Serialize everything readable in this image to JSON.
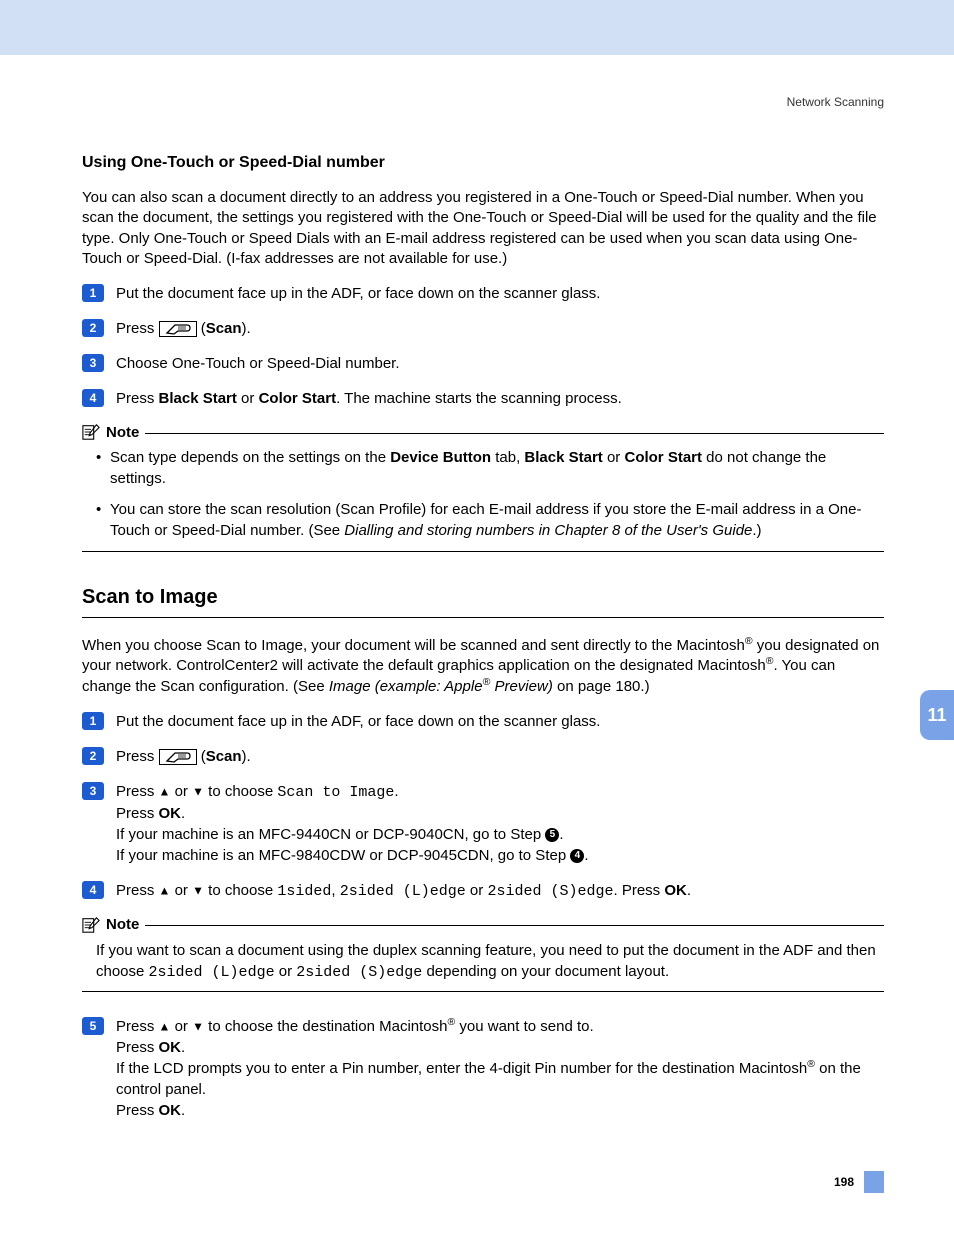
{
  "header": {
    "section": "Network Scanning"
  },
  "sideTab": "11",
  "section1": {
    "title": "Using One-Touch or Speed-Dial number",
    "intro": "You can also scan a document directly to an address you registered in a One-Touch or Speed-Dial number. When you scan the document, the settings you registered with the One-Touch or Speed-Dial will be used for the quality and the file type. Only One-Touch or Speed Dials with an E-mail address registered can be used when you scan data using One-Touch or Speed-Dial. (I-fax addresses are not available for use.)",
    "steps": {
      "s1": "Put the document face up in the ADF, or face down on the scanner glass.",
      "s2_press": "Press ",
      "s2_scan": "Scan",
      "s3": "Choose One-Touch or Speed-Dial number.",
      "s4_a": "Press ",
      "s4_b1": "Black Start",
      "s4_or": " or ",
      "s4_b2": "Color Start",
      "s4_c": ". The machine starts the scanning process."
    },
    "note": {
      "label": "Note",
      "b1_a": "Scan type depends on the settings on the ",
      "b1_b": "Device Button",
      "b1_c": " tab, ",
      "b1_d": "Black Start",
      "b1_e": " or ",
      "b1_f": "Color Start",
      "b1_g": " do not change the settings.",
      "b2_a": "You can store the scan resolution (Scan Profile) for each E-mail address if you store the E-mail address in a One-Touch or Speed-Dial number. (See ",
      "b2_b": "Dialling and storing numbers in Chapter 8 of the User's Guide",
      "b2_c": ".)"
    }
  },
  "section2": {
    "title": "Scan to Image",
    "intro_a": "When you choose Scan to Image, your document will be scanned and sent directly to the Macintosh",
    "intro_b": " you designated on your network. ControlCenter2 will activate the default graphics application on the designated Macintosh",
    "intro_c": ". You can change the Scan configuration. (See ",
    "intro_d": "Image (example: Apple",
    "intro_e": " Preview)",
    "intro_f": " on page 180.)",
    "steps": {
      "s1": "Put the document face up in the ADF, or face down on the scanner glass.",
      "s2_press": "Press ",
      "s2_scan": "Scan",
      "s3_a": "Press ",
      "s3_b": " or ",
      "s3_c": " to choose ",
      "s3_d": "Scan to Image",
      "s3_e": ".",
      "s3_f": "Press ",
      "s3_g": "OK",
      "s3_h": ".",
      "s3_i": "If your machine is an MFC-9440CN or DCP-9040CN, go to Step ",
      "s3_j": ".",
      "s3_k": "If your machine is an MFC-9840CDW or DCP-9045CDN, go to Step ",
      "s3_l": ".",
      "s4_a": "Press ",
      "s4_b": " or ",
      "s4_c": " to choose ",
      "s4_d1": "1sided",
      "s4_d2": "2sided (L)edge",
      "s4_d3": "2sided (S)edge",
      "s4_e": ". Press ",
      "s4_f": "OK",
      "s4_g": ".",
      "s5_a": "Press ",
      "s5_b": " or ",
      "s5_c": " to choose the destination Macintosh",
      "s5_d": " you want to send to.",
      "s5_e": "Press ",
      "s5_f": "OK",
      "s5_g": ".",
      "s5_h": "If the LCD prompts you to enter a Pin number, enter the 4-digit Pin number for the destination Macintosh",
      "s5_i": " on the control panel.",
      "s5_j": "Press ",
      "s5_k": "OK",
      "s5_l": "."
    },
    "note": {
      "label": "Note",
      "a": "If you want to scan a document using the duplex scanning feature, you need to put the document in the ADF and then choose ",
      "b": "2sided (L)edge",
      "c": " or ",
      "d": "2sided (S)edge",
      "e": " depending on your document layout."
    }
  },
  "footer": {
    "page": "198"
  },
  "glyphs": {
    "reg": "®",
    "up": "▲",
    "down": "▼",
    "comma": ", ",
    "or": " or "
  }
}
